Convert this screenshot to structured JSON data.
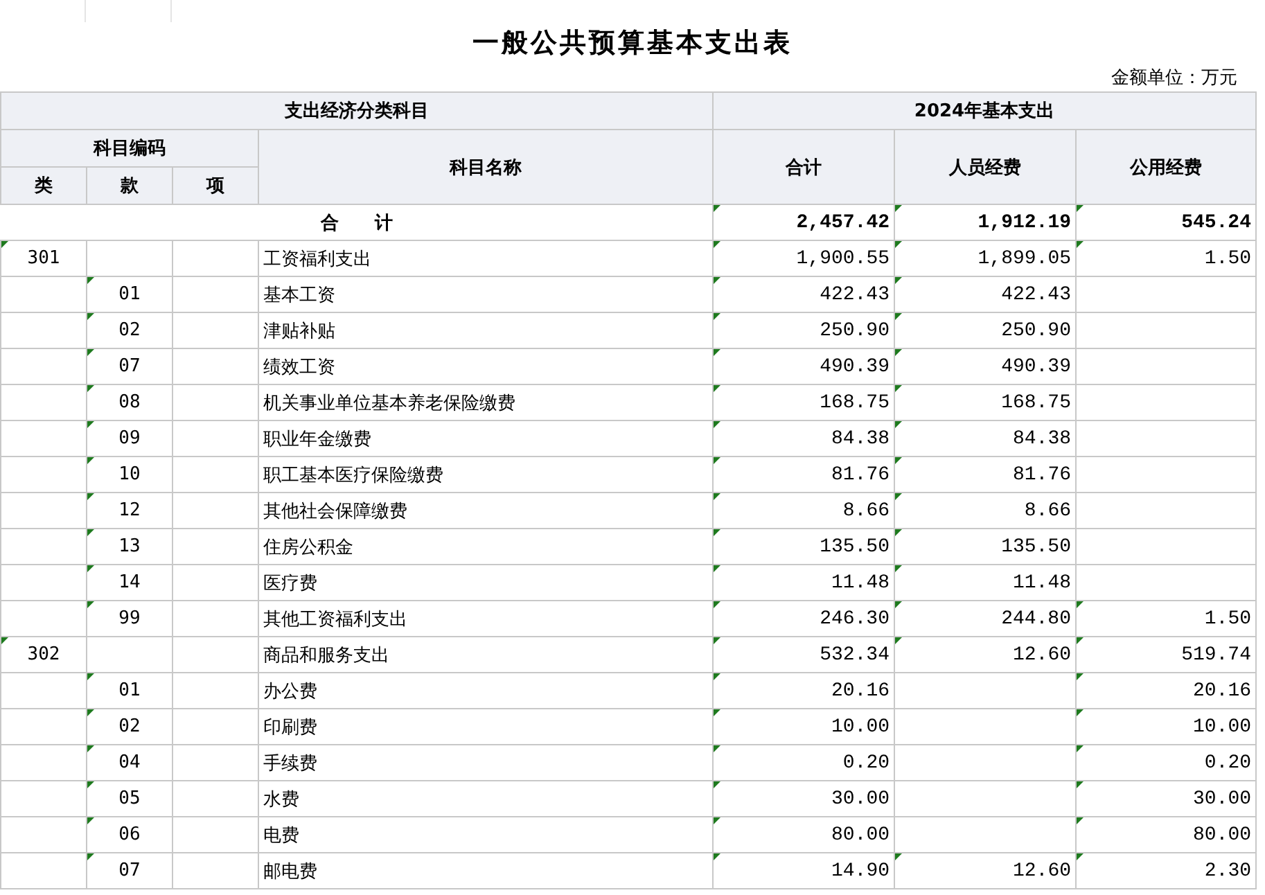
{
  "title": "一般公共预算基本支出表",
  "unit": "金额单位：万元",
  "header": {
    "group_left": "支出经济分类科目",
    "group_right": "2024年基本支出",
    "code_group": "科目编码",
    "code_columns": [
      "类",
      "款",
      "项"
    ],
    "name_column": "科目名称",
    "value_columns": [
      "合计",
      "人员经费",
      "公用经费"
    ]
  },
  "total_row": {
    "label": "合　　计",
    "total": "2,457.42",
    "personnel": "1,912.19",
    "public": "545.24",
    "flagged": true
  },
  "rows": [
    {
      "lei": "301",
      "kuan": "",
      "xiang": "",
      "name": "工资福利支出",
      "total": "1,900.55",
      "personnel": "1,899.05",
      "public": "1.50",
      "flagged": true
    },
    {
      "lei": "",
      "kuan": "01",
      "xiang": "",
      "name": "基本工资",
      "total": "422.43",
      "personnel": "422.43",
      "public": "",
      "flagged": true
    },
    {
      "lei": "",
      "kuan": "02",
      "xiang": "",
      "name": "津贴补贴",
      "total": "250.90",
      "personnel": "250.90",
      "public": "",
      "flagged": true
    },
    {
      "lei": "",
      "kuan": "07",
      "xiang": "",
      "name": "绩效工资",
      "total": "490.39",
      "personnel": "490.39",
      "public": "",
      "flagged": true
    },
    {
      "lei": "",
      "kuan": "08",
      "xiang": "",
      "name": "机关事业单位基本养老保险缴费",
      "total": "168.75",
      "personnel": "168.75",
      "public": "",
      "flagged": true
    },
    {
      "lei": "",
      "kuan": "09",
      "xiang": "",
      "name": "职业年金缴费",
      "total": "84.38",
      "personnel": "84.38",
      "public": "",
      "flagged": true
    },
    {
      "lei": "",
      "kuan": "10",
      "xiang": "",
      "name": "职工基本医疗保险缴费",
      "total": "81.76",
      "personnel": "81.76",
      "public": "",
      "flagged": true
    },
    {
      "lei": "",
      "kuan": "12",
      "xiang": "",
      "name": "其他社会保障缴费",
      "total": "8.66",
      "personnel": "8.66",
      "public": "",
      "flagged": true
    },
    {
      "lei": "",
      "kuan": "13",
      "xiang": "",
      "name": "住房公积金",
      "total": "135.50",
      "personnel": "135.50",
      "public": "",
      "flagged": true
    },
    {
      "lei": "",
      "kuan": "14",
      "xiang": "",
      "name": "医疗费",
      "total": "11.48",
      "personnel": "11.48",
      "public": "",
      "flagged": true
    },
    {
      "lei": "",
      "kuan": "99",
      "xiang": "",
      "name": "其他工资福利支出",
      "total": "246.30",
      "personnel": "244.80",
      "public": "1.50",
      "flagged": true
    },
    {
      "lei": "302",
      "kuan": "",
      "xiang": "",
      "name": "商品和服务支出",
      "total": "532.34",
      "personnel": "12.60",
      "public": "519.74",
      "flagged": true
    },
    {
      "lei": "",
      "kuan": "01",
      "xiang": "",
      "name": "办公费",
      "total": "20.16",
      "personnel": "",
      "public": "20.16",
      "flagged": true
    },
    {
      "lei": "",
      "kuan": "02",
      "xiang": "",
      "name": "印刷费",
      "total": "10.00",
      "personnel": "",
      "public": "10.00",
      "flagged": true
    },
    {
      "lei": "",
      "kuan": "04",
      "xiang": "",
      "name": "手续费",
      "total": "0.20",
      "personnel": "",
      "public": "0.20",
      "flagged": true
    },
    {
      "lei": "",
      "kuan": "05",
      "xiang": "",
      "name": "水费",
      "total": "30.00",
      "personnel": "",
      "public": "30.00",
      "flagged": true
    },
    {
      "lei": "",
      "kuan": "06",
      "xiang": "",
      "name": "电费",
      "total": "80.00",
      "personnel": "",
      "public": "80.00",
      "flagged": true
    },
    {
      "lei": "",
      "kuan": "07",
      "xiang": "",
      "name": "邮电费",
      "total": "14.90",
      "personnel": "12.60",
      "public": "2.30",
      "flagged": true
    }
  ]
}
